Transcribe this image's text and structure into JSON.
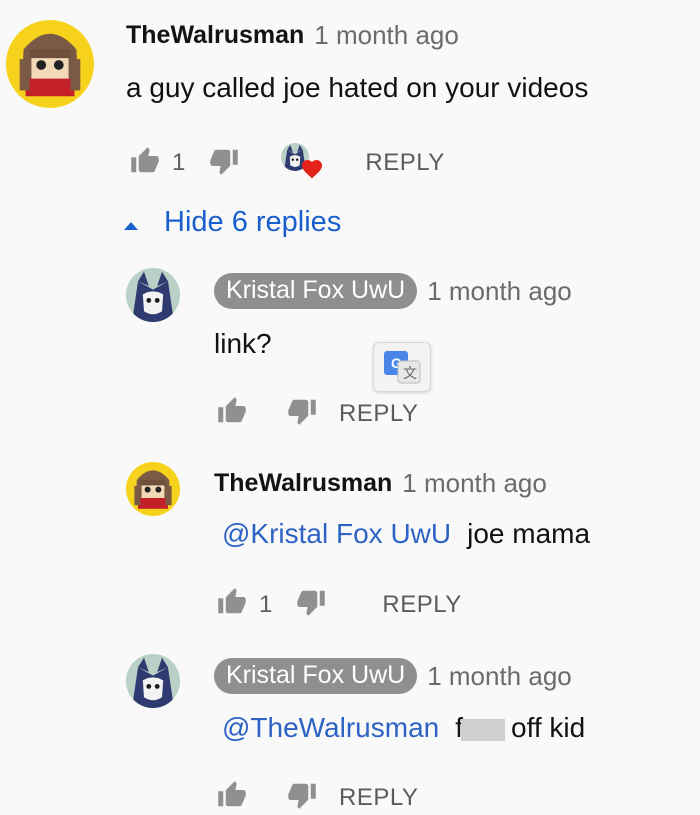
{
  "colors": {
    "link": "#2e63c6",
    "pill_bg": "#8f8f8f",
    "heart": "#e62117"
  },
  "comment": {
    "author": "TheWalrusman",
    "timestamp": "1 month ago",
    "text": "a guy called joe hated on your videos",
    "like_count": "1",
    "reply_label": "REPLY",
    "hide_replies_label": "Hide 6 replies"
  },
  "replies": [
    {
      "author": "Kristal Fox UwU",
      "timestamp": "1 month ago",
      "text": "link?",
      "like_count": "",
      "reply_label": "REPLY"
    },
    {
      "author": "TheWalrusman",
      "timestamp": "1 month ago",
      "mention": "@Kristal Fox UwU",
      "text": "joe mama",
      "like_count": "1",
      "reply_label": "REPLY"
    },
    {
      "author": "Kristal Fox UwU",
      "timestamp": "1 month ago",
      "mention": "@TheWalrusman",
      "text_prefix": "f",
      "text_suffix": "off kid",
      "like_count": "",
      "reply_label": "REPLY"
    }
  ]
}
